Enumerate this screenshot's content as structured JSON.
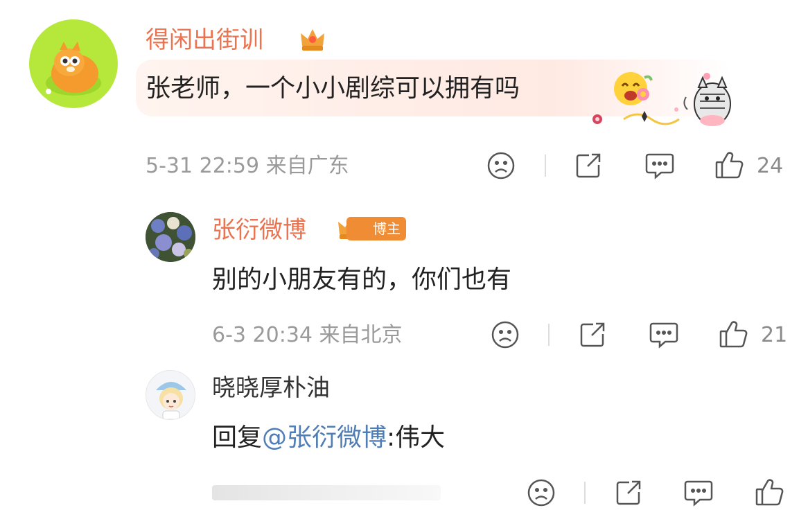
{
  "comments": [
    {
      "username": "得闲出街训",
      "text": "张老师，一个小小剧综可以拥有吗",
      "meta": "5-31 22:59 来自广东",
      "likes": "24"
    },
    {
      "username": "张衍微博",
      "badge": "博主",
      "text": "别的小朋友有的，你们也有",
      "meta": "6-3 20:34 来自北京",
      "likes": "21"
    },
    {
      "username": "晓晓厚朴油",
      "reply_prefix": "回复",
      "mention": "@张衍微博",
      "reply_text": ":伟大"
    }
  ],
  "colors": {
    "username_orange": "#eb7350",
    "mention_blue": "#4f7db5",
    "meta_gray": "#9a9a9a",
    "badge_orange": "#f08c33"
  },
  "icons": [
    "frown-icon",
    "share-icon",
    "comment-icon",
    "thumbs-up-icon"
  ]
}
